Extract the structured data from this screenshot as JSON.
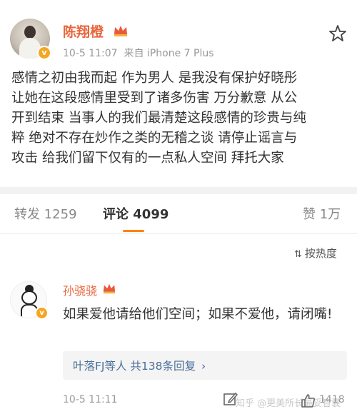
{
  "post": {
    "username": "陈翔橙",
    "time": "10-5 11:07",
    "source": "来自 iPhone 7 Plus",
    "content_lines": [
      "感情之初由我而起 作为男人 是我没有保护好晓彤",
      "让她在这段感情里受到了诸多伤害 万分歉意 从公",
      "开到结束 当事人的我们最清楚这段感情的珍贵与纯",
      "粹 绝对不存在炒作之类的无稽之谈 请停止谣言与",
      "攻击 给我们留下仅有的一点私人空间 拜托大家"
    ]
  },
  "tabs": {
    "repost": "转发 1259",
    "comment": "评论 4099",
    "like": "赞 1万"
  },
  "sort": {
    "label": "按热度"
  },
  "comment": {
    "username": "孙骁骁",
    "text": "如果爱他请给他们空间；如果不爱他，请闭嘴!",
    "replies": "叶落FJ等人  共138条回复",
    "time": "10-5 11:11",
    "like_count": "1418",
    "watermark": "知乎 @更美所长最妥智囊"
  },
  "colors": {
    "accent": "#e8663d",
    "tab_indicator": "#ff8200",
    "link": "#4a6f9a",
    "badge": "#f5a623"
  },
  "icons": {
    "star": "star-icon",
    "crown": "crown-icon",
    "verified": "verified-badge-icon",
    "sort": "sort-icon",
    "chevron": "chevron-right-icon",
    "edit": "edit-icon",
    "like": "thumb-up-icon"
  }
}
